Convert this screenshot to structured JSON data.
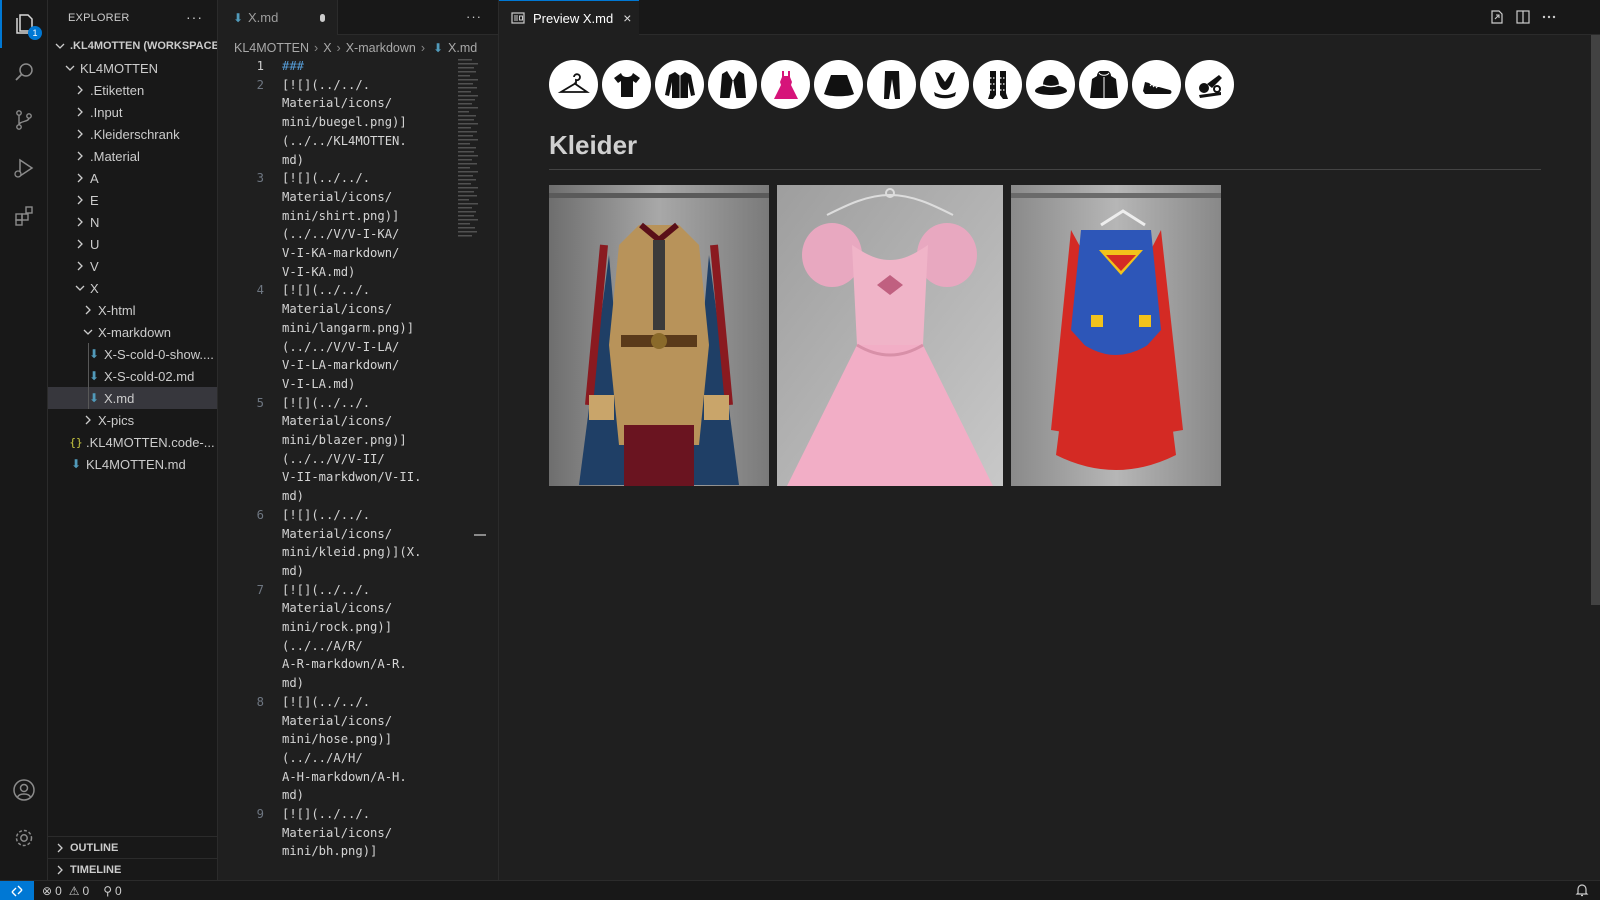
{
  "activity": {
    "explorer_badge": "1",
    "items": [
      "explorer",
      "search",
      "source-control",
      "run-debug",
      "extensions",
      "accounts",
      "manage"
    ]
  },
  "explorer": {
    "title": "EXPLORER",
    "more": "···",
    "workspace": ".KL4MOTTEN (WORKSPACE)",
    "root": "KL4MOTTEN",
    "folders": [
      ".Etiketten",
      ".Input",
      ".Kleiderschrank",
      ".Material",
      "A",
      "E",
      "N",
      "U",
      "V",
      "X"
    ],
    "x_children": [
      "X-html",
      "X-markdown"
    ],
    "markdown_files": [
      "X-S-cold-0-show....",
      "X-S-cold-02.md",
      "X.md"
    ],
    "x_pics": "X-pics",
    "root_files": [
      ".KL4MOTTEN.code-...",
      "KL4MOTTEN.md"
    ],
    "json_glyph": "{}",
    "outline": "OUTLINE",
    "timeline": "TIMELINE"
  },
  "editor1": {
    "tab_label": "X.md",
    "more": "···",
    "breadcrumb": [
      "KL4MOTTEN",
      "X",
      "X-markdown",
      "X.md"
    ],
    "line_numbers": [
      "1",
      "2",
      "3",
      "4",
      "5",
      "6",
      "7",
      "8",
      "9"
    ],
    "code_lines": [
      [
        "###"
      ],
      [
        "[![](../../.",
        "Material/icons/",
        "mini/buegel.png)]",
        "(../../KL4MOTTEN.",
        "md)"
      ],
      [
        "[![](../../.",
        "Material/icons/",
        "mini/shirt.png)]",
        "(../../V/V-I-KA/",
        "V-I-KA-markdown/",
        "V-I-KA.md)"
      ],
      [
        "[![](../../.",
        "Material/icons/",
        "mini/langarm.png)]",
        "(../../V/V-I-LA/",
        "V-I-LA-markdown/",
        "V-I-LA.md)"
      ],
      [
        "[![](../../.",
        "Material/icons/",
        "mini/blazer.png)]",
        "(../../V/V-II/",
        "V-II-markdwon/V-II.",
        "md)"
      ],
      [
        "[![](../../.",
        "Material/icons/",
        "mini/kleid.png)](X.",
        "md)"
      ],
      [
        "[![](../../.",
        "Material/icons/",
        "mini/rock.png)]",
        "(../../A/R/",
        "A-R-markdown/A-R.",
        "md)"
      ],
      [
        "[![](../../.",
        "Material/icons/",
        "mini/hose.png)]",
        "(../../A/H/",
        "A-H-markdown/A-H.",
        "md)"
      ],
      [
        "[![](../../.",
        "Material/icons/",
        "mini/bh.png)]"
      ]
    ]
  },
  "editor2": {
    "tab_label": "Preview X.md",
    "close": "×",
    "heading": "Kleider",
    "category_icons": [
      "buegel-icon",
      "shirt-icon",
      "langarm-icon",
      "blazer-icon",
      "kleid-icon",
      "rock-icon",
      "hose-icon",
      "bh-icon",
      "strumpf-icon",
      "hut-icon",
      "jacke-icon",
      "schuh-icon",
      "accessoire-icon"
    ],
    "photos": [
      "medieval-costume-photo",
      "pink-princess-dress-photo",
      "superman-costume-photo"
    ]
  },
  "statusbar": {
    "errors": "0",
    "warnings": "0",
    "ports": "0"
  },
  "colors": {
    "accent": "#0078d4",
    "kleid_icon": "#d6147a",
    "background": "#1f1f1f"
  }
}
